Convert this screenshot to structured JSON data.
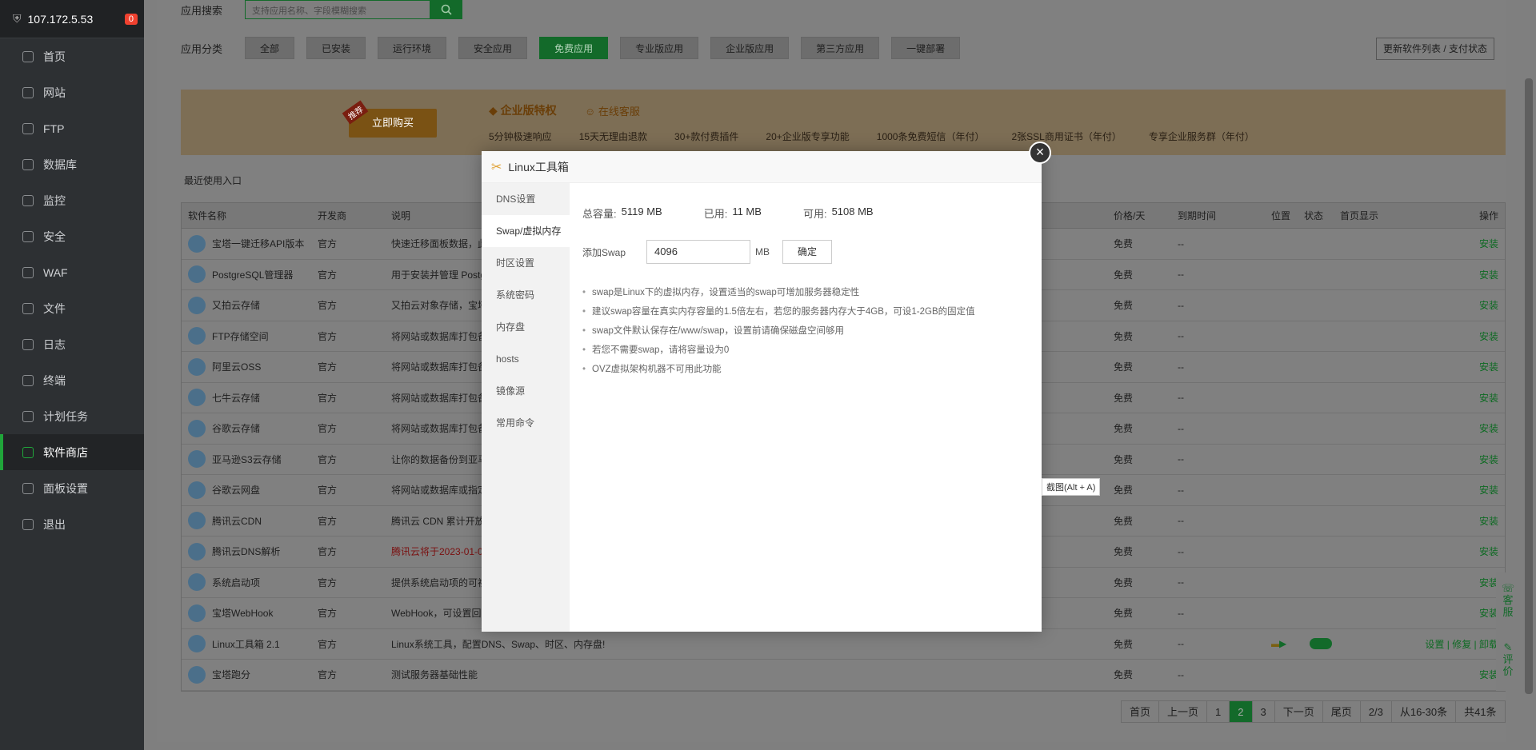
{
  "sidebar": {
    "ip": "107.172.5.53",
    "badge": "0",
    "items": [
      {
        "label": "首页",
        "icon": "home-icon"
      },
      {
        "label": "网站",
        "icon": "globe-icon"
      },
      {
        "label": "FTP",
        "icon": "ftp-icon"
      },
      {
        "label": "数据库",
        "icon": "database-icon"
      },
      {
        "label": "监控",
        "icon": "monitor-icon"
      },
      {
        "label": "安全",
        "icon": "shield-icon"
      },
      {
        "label": "WAF",
        "icon": "waf-icon"
      },
      {
        "label": "文件",
        "icon": "folder-icon"
      },
      {
        "label": "日志",
        "icon": "log-icon"
      },
      {
        "label": "终端",
        "icon": "terminal-icon"
      },
      {
        "label": "计划任务",
        "icon": "clock-icon"
      },
      {
        "label": "软件商店",
        "icon": "store-icon"
      },
      {
        "label": "面板设置",
        "icon": "gear-icon"
      },
      {
        "label": "退出",
        "icon": "logout-icon"
      }
    ],
    "active_index": 11
  },
  "search": {
    "label": "应用搜索",
    "placeholder": "支持应用名称、字段模糊搜索"
  },
  "categories": {
    "label": "应用分类",
    "items": [
      "全部",
      "已安装",
      "运行环境",
      "安全应用",
      "免费应用",
      "专业版应用",
      "企业版应用",
      "第三方应用",
      "一键部署"
    ],
    "active_index": 4
  },
  "update_button": "更新软件列表 / 支付状态",
  "banner": {
    "tag": "推荐",
    "buy": "立即购买",
    "title": "企业版特权",
    "service": "在线客服",
    "features": [
      "5分钟极速响应",
      "15天无理由退款",
      "30+款付费插件",
      "20+企业版专享功能",
      "1000条免费短信（年付）",
      "2张SSL商用证书（年付）",
      "专享企业服务群（年付）"
    ]
  },
  "recent_label": "最近使用入口",
  "table": {
    "headers": {
      "name": "软件名称",
      "dev": "开发商",
      "desc": "说明",
      "price": "价格/天",
      "expire": "到期时间",
      "pos": "位置",
      "status": "状态",
      "home": "首页显示",
      "op": "操作"
    },
    "rows": [
      {
        "name": "宝塔一键迁移API版本",
        "dev": "官方",
        "desc": "快速迁移面板数据，此",
        "price": "免费",
        "expire": "--",
        "op": "安装"
      },
      {
        "name": "PostgreSQL管理器",
        "dev": "官方",
        "desc": "用于安装并管理 Postgr",
        "price": "免费",
        "expire": "--",
        "op": "安装"
      },
      {
        "name": "又拍云存储",
        "dev": "官方",
        "desc": "又拍云对象存储，宝塔",
        "price": "免费",
        "expire": "--",
        "op": "安装"
      },
      {
        "name": "FTP存储空间",
        "dev": "官方",
        "desc": "将网站或数据库打包备份",
        "price": "免费",
        "expire": "--",
        "op": "安装"
      },
      {
        "name": "阿里云OSS",
        "dev": "官方",
        "desc": "将网站或数据库打包备份",
        "price": "免费",
        "expire": "--",
        "op": "安装"
      },
      {
        "name": "七牛云存储",
        "dev": "官方",
        "desc": "将网站或数据库打包备份",
        "price": "免费",
        "expire": "--",
        "op": "安装"
      },
      {
        "name": "谷歌云存储",
        "dev": "官方",
        "desc": "将网站或数据库打包备份",
        "price": "免费",
        "expire": "--",
        "op": "安装"
      },
      {
        "name": "亚马逊S3云存储",
        "dev": "官方",
        "desc": "让你的数据备份到亚马逊",
        "price": "免费",
        "expire": "--",
        "op": "安装"
      },
      {
        "name": "谷歌云网盘",
        "dev": "官方",
        "desc": "将网站或数据库或指定目",
        "price": "免费",
        "expire": "--",
        "op": "安装"
      },
      {
        "name": "腾讯云CDN",
        "dev": "官方",
        "desc": "腾讯云 CDN 累计开放了",
        "price": "免费",
        "expire": "--",
        "op": "安装"
      },
      {
        "name": "腾讯云DNS解析",
        "dev": "官方",
        "desc": "腾讯云将于2023-01-01",
        "price": "免费",
        "expire": "--",
        "op": "安装"
      },
      {
        "name": "系统启动项",
        "dev": "官方",
        "desc": "提供系统启动项的可视化",
        "price": "免费",
        "expire": "--",
        "op": "安装"
      },
      {
        "name": "宝塔WebHook",
        "dev": "官方",
        "desc": "WebHook，可设置回调",
        "price": "免费",
        "expire": "--",
        "op": "安装"
      },
      {
        "name": "Linux工具箱 2.1",
        "dev": "官方",
        "desc": "Linux系统工具，配置DNS、Swap、时区、内存盘!",
        "price": "免费",
        "expire": "--",
        "op": "设置 | 修复 | 卸载"
      },
      {
        "name": "宝塔跑分",
        "dev": "官方",
        "desc": "测试服务器基础性能",
        "price": "免费",
        "expire": "--",
        "op": "安装"
      }
    ]
  },
  "pager": [
    "首页",
    "上一页",
    "1",
    "2",
    "3",
    "下一页",
    "尾页",
    "2/3",
    "从16-30条",
    "共41条"
  ],
  "pager_current": "2",
  "float": {
    "service": "客服",
    "review": "评价"
  },
  "modal": {
    "title": "Linux工具箱",
    "close": "×",
    "nav": [
      "DNS设置",
      "Swap/虚拟内存",
      "时区设置",
      "系统密码",
      "内存盘",
      "hosts",
      "镜像源",
      "常用命令"
    ],
    "nav_active": 1,
    "total_label": "总容量:",
    "total": "5119 MB",
    "used_label": "已用:",
    "used": "11 MB",
    "free_label": "可用:",
    "free": "5108 MB",
    "add_label": "添加Swap",
    "add_value": "4096",
    "unit": "MB",
    "confirm": "确定",
    "tips": [
      "swap是Linux下的虚拟内存，设置适当的swap可增加服务器稳定性",
      "建议swap容量在真实内存容量的1.5倍左右，若您的服务器内存大于4GB，可设1-2GB的固定值",
      "swap文件默认保存在/www/swap，设置前请确保磁盘空间够用",
      "若您不需要swap，请将容量设为0",
      "OVZ虚拟架构机器不可用此功能"
    ]
  },
  "tooltip": "截图(Alt + A)"
}
